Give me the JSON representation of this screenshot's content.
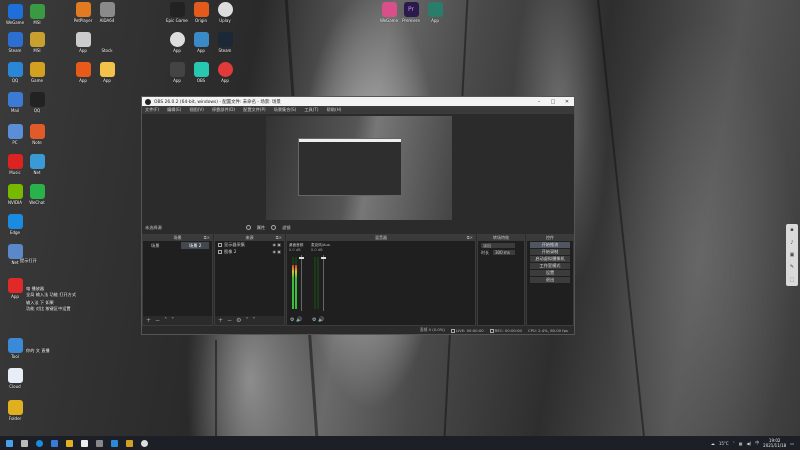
{
  "desktop": {
    "icons": [
      {
        "label": "WeGame",
        "color": "#1e6fd9"
      },
      {
        "label": "MSI",
        "color": "#3a9a44"
      },
      {
        "label": "PotPlayer",
        "color": "#e07b22"
      },
      {
        "label": "AIDA64",
        "color": "#8a8a8a"
      },
      {
        "label": "Epic Games Launcher",
        "color": "#222"
      },
      {
        "label": "Origin",
        "color": "#e35a1b"
      },
      {
        "label": "Uplay",
        "color": "#ddd"
      },
      {
        "label": "WeGame",
        "color": "#d94f8a"
      },
      {
        "label": "Pr",
        "color": "#2a1b4a"
      },
      {
        "label": "JetBrains",
        "color": "#2a7d6a"
      }
    ],
    "notes": [
      "提示打开",
      "电 播放器",
      "输入法 下 如果",
      "你的 文 直播",
      "全局 输入法 功能 打开方式",
      "功能 对比 按键区中设置"
    ]
  },
  "obs": {
    "title": "OBS 26.0.2 (64-bit, windows) - 配置文件: 未命名 - 场景: 场景",
    "menu": [
      "文件(F)",
      "编辑(E)",
      "视图(V)",
      "停靠部件(D)",
      "配置文件(P)",
      "场景集合(S)",
      "工具(T)",
      "帮助(H)"
    ],
    "scenebar_left": "未选择源",
    "scenebar_props": "属性",
    "scenebar_filters": "滤镜",
    "docks": {
      "scenes": "场景",
      "sources": "来源",
      "mixer": "混音器",
      "transitions": "转场特效",
      "controls": "控件"
    },
    "scenes": [
      "场景",
      "场景 2"
    ],
    "scene_active": "场景 2",
    "sources": [
      "显示器采集",
      "图像 2"
    ],
    "mixer": [
      {
        "name": "桌面音频",
        "db": "0.0 dB",
        "level": 0.85
      },
      {
        "name": "麦克风/Aux",
        "db": "0.0 dB",
        "level": 0.0
      }
    ],
    "transitions": {
      "type": "淡出",
      "duration_label": "时长",
      "duration": "300 ms"
    },
    "controls": [
      "开始推流",
      "开始录制",
      "启动虚拟摄像机",
      "工作室模式",
      "设置",
      "退出"
    ],
    "status": {
      "drop": "丢帧 0 (0.0%)",
      "live": "LIVE: 00:00:00",
      "rec": "REC: 00:00:00",
      "cpu": "CPU: 2.4%, 60.00 fps"
    }
  },
  "taskbar": {
    "temp": "15°C",
    "time": "19:02",
    "date": "2021/11/18"
  }
}
